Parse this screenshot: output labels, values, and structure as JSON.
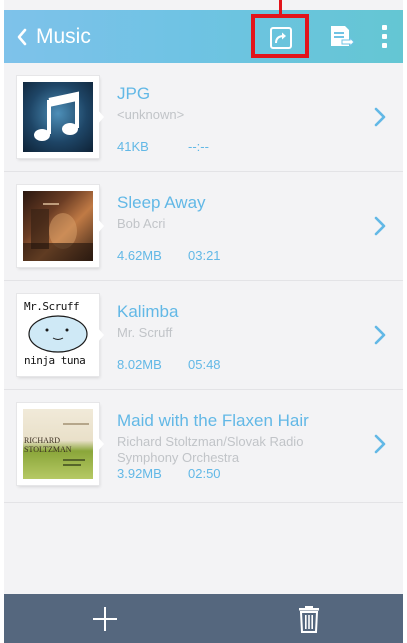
{
  "header": {
    "title": "Music"
  },
  "tracks": [
    {
      "name": "JPG",
      "artist": "<unknown>",
      "size": "41KB",
      "duration": "--:--"
    },
    {
      "name": "Sleep Away",
      "artist": "Bob Acri",
      "size": "4.62MB",
      "duration": "03:21"
    },
    {
      "name": "Kalimba",
      "artist": "Mr. Scruff",
      "size": "8.02MB",
      "duration": "05:48",
      "art_text": [
        "Mr.Scruff",
        "ninja tuna"
      ]
    },
    {
      "name": "Maid with the Flaxen Hair",
      "artist": "Richard Stoltzman/Slovak Radio Symphony Orchestra",
      "size": "3.92MB",
      "duration": "02:50",
      "art_text": [
        "RICHARD",
        "STOLTZMAN"
      ]
    }
  ],
  "icons": {
    "back": "chevron-left-icon",
    "share": "share-icon",
    "export": "export-icon",
    "more": "more-vertical-icon",
    "row_arrow": "chevron-right-icon",
    "add": "plus-icon",
    "delete": "trash-icon"
  },
  "colors": {
    "appbar_start": "#7ec2ea",
    "appbar_end": "#64c6d3",
    "accent_text": "#62b8e6",
    "secondary_text": "#c1c4c8",
    "highlight": "#e2141b",
    "bottombar": "#55677e"
  }
}
